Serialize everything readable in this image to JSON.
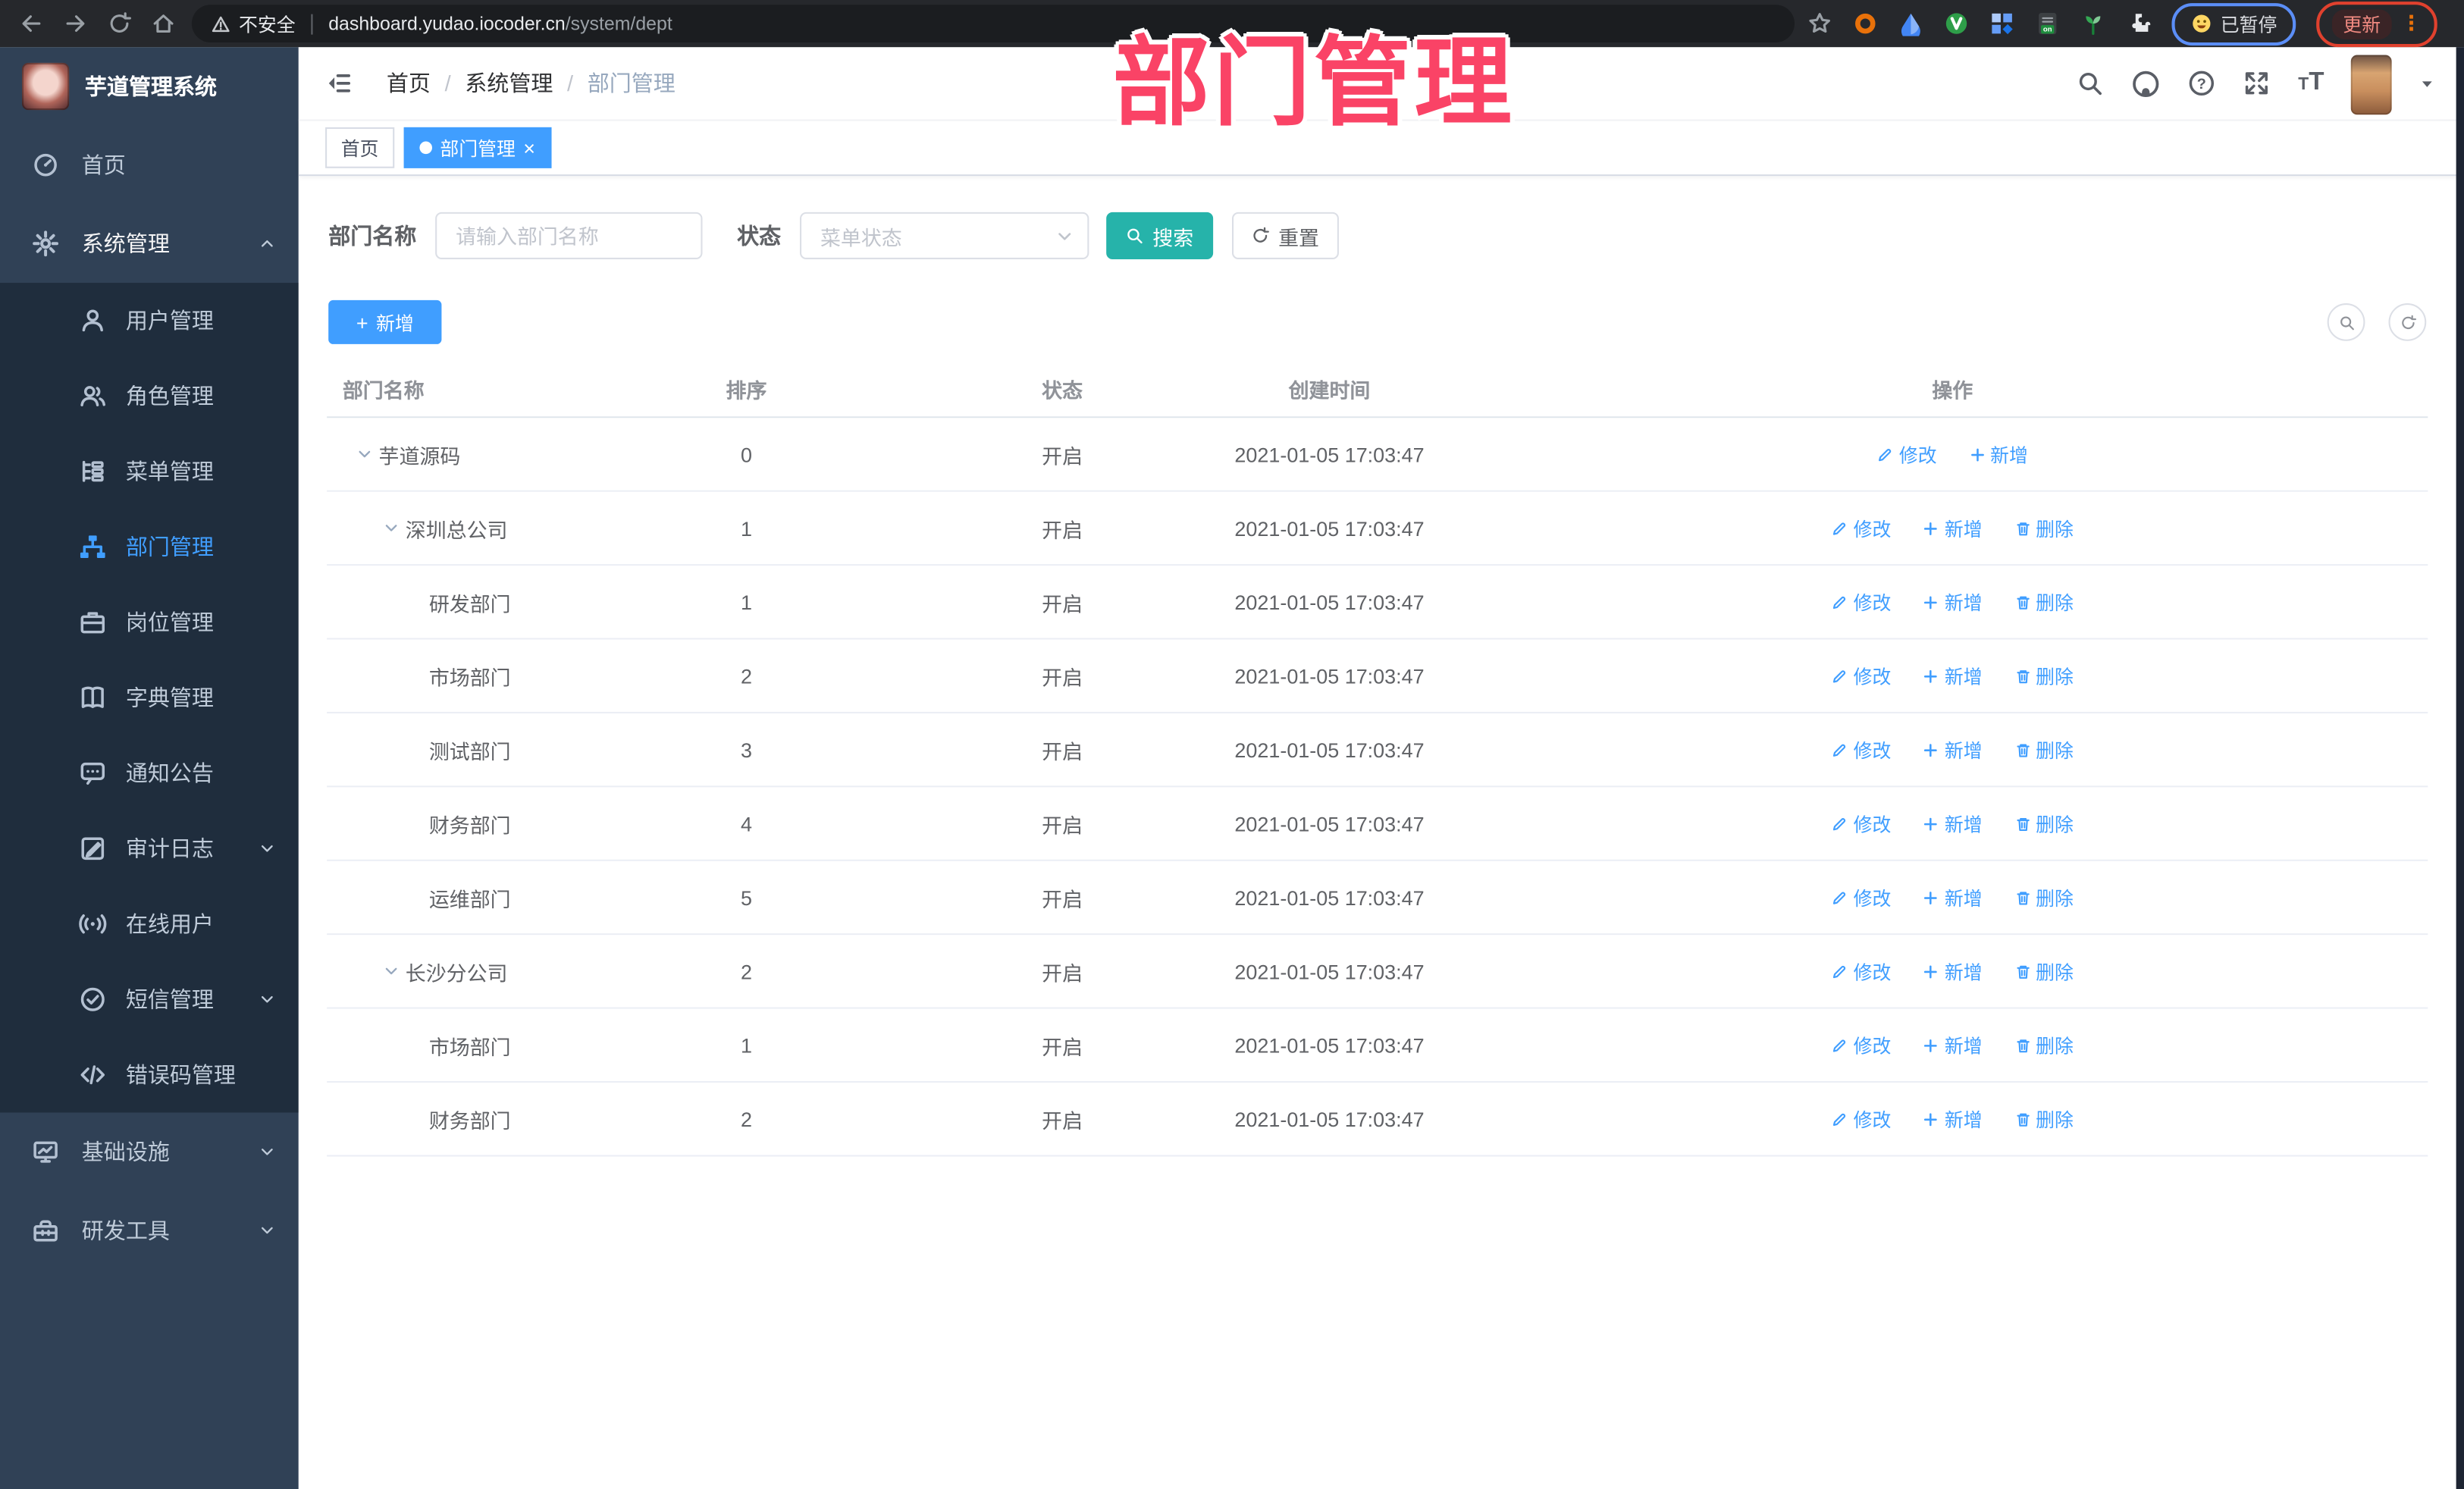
{
  "browser": {
    "security_label": "不安全",
    "url_host": "dashboard.yudao.iocoder.cn",
    "url_path": "/system/dept",
    "paused_label": "已暂停",
    "update_label": "更新",
    "kebab": "⋮",
    "extensions": [
      "ext-target-icon",
      "ext-drop-icon",
      "ext-green-v-icon",
      "ext-squares-icon",
      "ext-dark-on-icon",
      "ext-sprout-icon",
      "ext-puzzle-icon"
    ]
  },
  "app": {
    "title": "芋道管理系统",
    "overlay_title": "部门管理",
    "breadcrumb": {
      "items": [
        "首页",
        "系统管理"
      ],
      "current": "部门管理",
      "separator": "/"
    },
    "tags": [
      {
        "label": "首页",
        "active": false,
        "closable": false
      },
      {
        "label": "部门管理",
        "active": true,
        "closable": true,
        "close_glyph": "×"
      }
    ]
  },
  "sidebar": {
    "home": {
      "label": "首页",
      "icon": "dashboard-icon"
    },
    "system": {
      "label": "系统管理",
      "icon": "gear-icon",
      "expanded": true
    },
    "system_children": [
      {
        "label": "用户管理",
        "icon": "user-icon"
      },
      {
        "label": "角色管理",
        "icon": "users-icon"
      },
      {
        "label": "菜单管理",
        "icon": "tree-table-icon"
      },
      {
        "label": "部门管理",
        "icon": "org-tree-icon",
        "active": true
      },
      {
        "label": "岗位管理",
        "icon": "briefcase-icon"
      },
      {
        "label": "字典管理",
        "icon": "dict-book-icon"
      },
      {
        "label": "通知公告",
        "icon": "message-icon"
      },
      {
        "label": "审计日志",
        "icon": "audit-log-icon",
        "chevron": true
      },
      {
        "label": "在线用户",
        "icon": "online-user-icon"
      },
      {
        "label": "短信管理",
        "icon": "sms-check-icon",
        "chevron": true
      },
      {
        "label": "错误码管理",
        "icon": "code-icon"
      }
    ],
    "bottom": [
      {
        "label": "基础设施",
        "icon": "monitor-icon",
        "chevron": true
      },
      {
        "label": "研发工具",
        "icon": "toolbox-icon",
        "chevron": true
      }
    ]
  },
  "filter": {
    "name_label": "部门名称",
    "name_placeholder": "请输入部门名称",
    "status_label": "状态",
    "status_placeholder": "菜单状态",
    "search_label": "搜索",
    "reset_label": "重置"
  },
  "toolbar": {
    "add_label": "新增"
  },
  "table": {
    "columns": [
      "部门名称",
      "排序",
      "状态",
      "创建时间",
      "操作"
    ],
    "action_labels": {
      "edit": "修改",
      "add": "新增",
      "delete": "删除"
    },
    "rows": [
      {
        "name": "芋道源码",
        "level": 0,
        "expandable": true,
        "sort": "0",
        "status": "开启",
        "created": "2021-01-05 17:03:47",
        "actions": [
          "edit",
          "add"
        ]
      },
      {
        "name": "深圳总公司",
        "level": 1,
        "expandable": true,
        "sort": "1",
        "status": "开启",
        "created": "2021-01-05 17:03:47",
        "actions": [
          "edit",
          "add",
          "delete"
        ]
      },
      {
        "name": "研发部门",
        "level": 2,
        "expandable": false,
        "sort": "1",
        "status": "开启",
        "created": "2021-01-05 17:03:47",
        "actions": [
          "edit",
          "add",
          "delete"
        ]
      },
      {
        "name": "市场部门",
        "level": 2,
        "expandable": false,
        "sort": "2",
        "status": "开启",
        "created": "2021-01-05 17:03:47",
        "actions": [
          "edit",
          "add",
          "delete"
        ]
      },
      {
        "name": "测试部门",
        "level": 2,
        "expandable": false,
        "sort": "3",
        "status": "开启",
        "created": "2021-01-05 17:03:47",
        "actions": [
          "edit",
          "add",
          "delete"
        ]
      },
      {
        "name": "财务部门",
        "level": 2,
        "expandable": false,
        "sort": "4",
        "status": "开启",
        "created": "2021-01-05 17:03:47",
        "actions": [
          "edit",
          "add",
          "delete"
        ]
      },
      {
        "name": "运维部门",
        "level": 2,
        "expandable": false,
        "sort": "5",
        "status": "开启",
        "created": "2021-01-05 17:03:47",
        "actions": [
          "edit",
          "add",
          "delete"
        ]
      },
      {
        "name": "长沙分公司",
        "level": 1,
        "expandable": true,
        "sort": "2",
        "status": "开启",
        "created": "2021-01-05 17:03:47",
        "actions": [
          "edit",
          "add",
          "delete"
        ]
      },
      {
        "name": "市场部门",
        "level": 2,
        "expandable": false,
        "sort": "1",
        "status": "开启",
        "created": "2021-01-05 17:03:47",
        "actions": [
          "edit",
          "add",
          "delete"
        ]
      },
      {
        "name": "财务部门",
        "level": 2,
        "expandable": false,
        "sort": "2",
        "status": "开启",
        "created": "2021-01-05 17:03:47",
        "actions": [
          "edit",
          "add",
          "delete"
        ]
      }
    ]
  },
  "colors": {
    "accent": "#409EFF",
    "search_button": "#26B3AA",
    "sidebar_bg": "#304156",
    "submenu_bg": "#1F2D3D",
    "annotation_pink": "#FA4366",
    "annotation_blue": "#5B8EF7",
    "annotation_red": "#E0412E"
  }
}
